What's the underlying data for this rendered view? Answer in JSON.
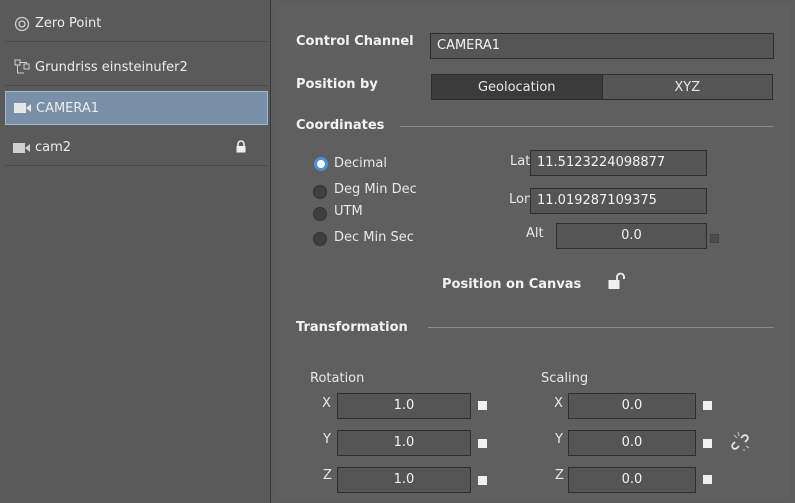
{
  "sidebar": {
    "items": [
      {
        "label": "Zero Point",
        "icon": "target-icon"
      },
      {
        "label": "Grundriss einsteinufer2",
        "icon": "hierarchy-icon"
      },
      {
        "label": "CAMERA1",
        "icon": "camera-icon",
        "selected": true
      },
      {
        "label": "cam2",
        "icon": "camera-icon",
        "locked": true
      }
    ]
  },
  "panel": {
    "control_channel_label": "Control Channel",
    "control_channel_value": "CAMERA1",
    "position_by_label": "Position by",
    "position_by_options": [
      "Geolocation",
      "XYZ"
    ],
    "position_by_selected": "Geolocation",
    "coordinates_label": "Coordinates",
    "coord_formats": [
      "Decimal",
      "Deg Min Dec",
      "UTM",
      "Dec Min Sec"
    ],
    "coord_format_selected": "Decimal",
    "lat_label": "Lat",
    "lat_value": "11.5123224098877",
    "lon_label": "Lon",
    "lon_value": "11.019287109375",
    "alt_label": "Alt",
    "alt_value": "0.0",
    "position_on_canvas_label": "Position on Canvas",
    "transformation_label": "Transformation",
    "rotation_label": "Rotation",
    "scaling_label": "Scaling",
    "rotation": {
      "x_label": "X",
      "x": "1.0",
      "y_label": "Y",
      "y": "1.0",
      "z_label": "Z",
      "z": "1.0"
    },
    "scaling": {
      "x_label": "X",
      "x": "0.0",
      "y_label": "Y",
      "y": "0.0",
      "z_label": "Z",
      "z": "0.0"
    }
  },
  "colors": {
    "selection": "#7a8fa8",
    "radio_accent": "#4a90d9"
  }
}
